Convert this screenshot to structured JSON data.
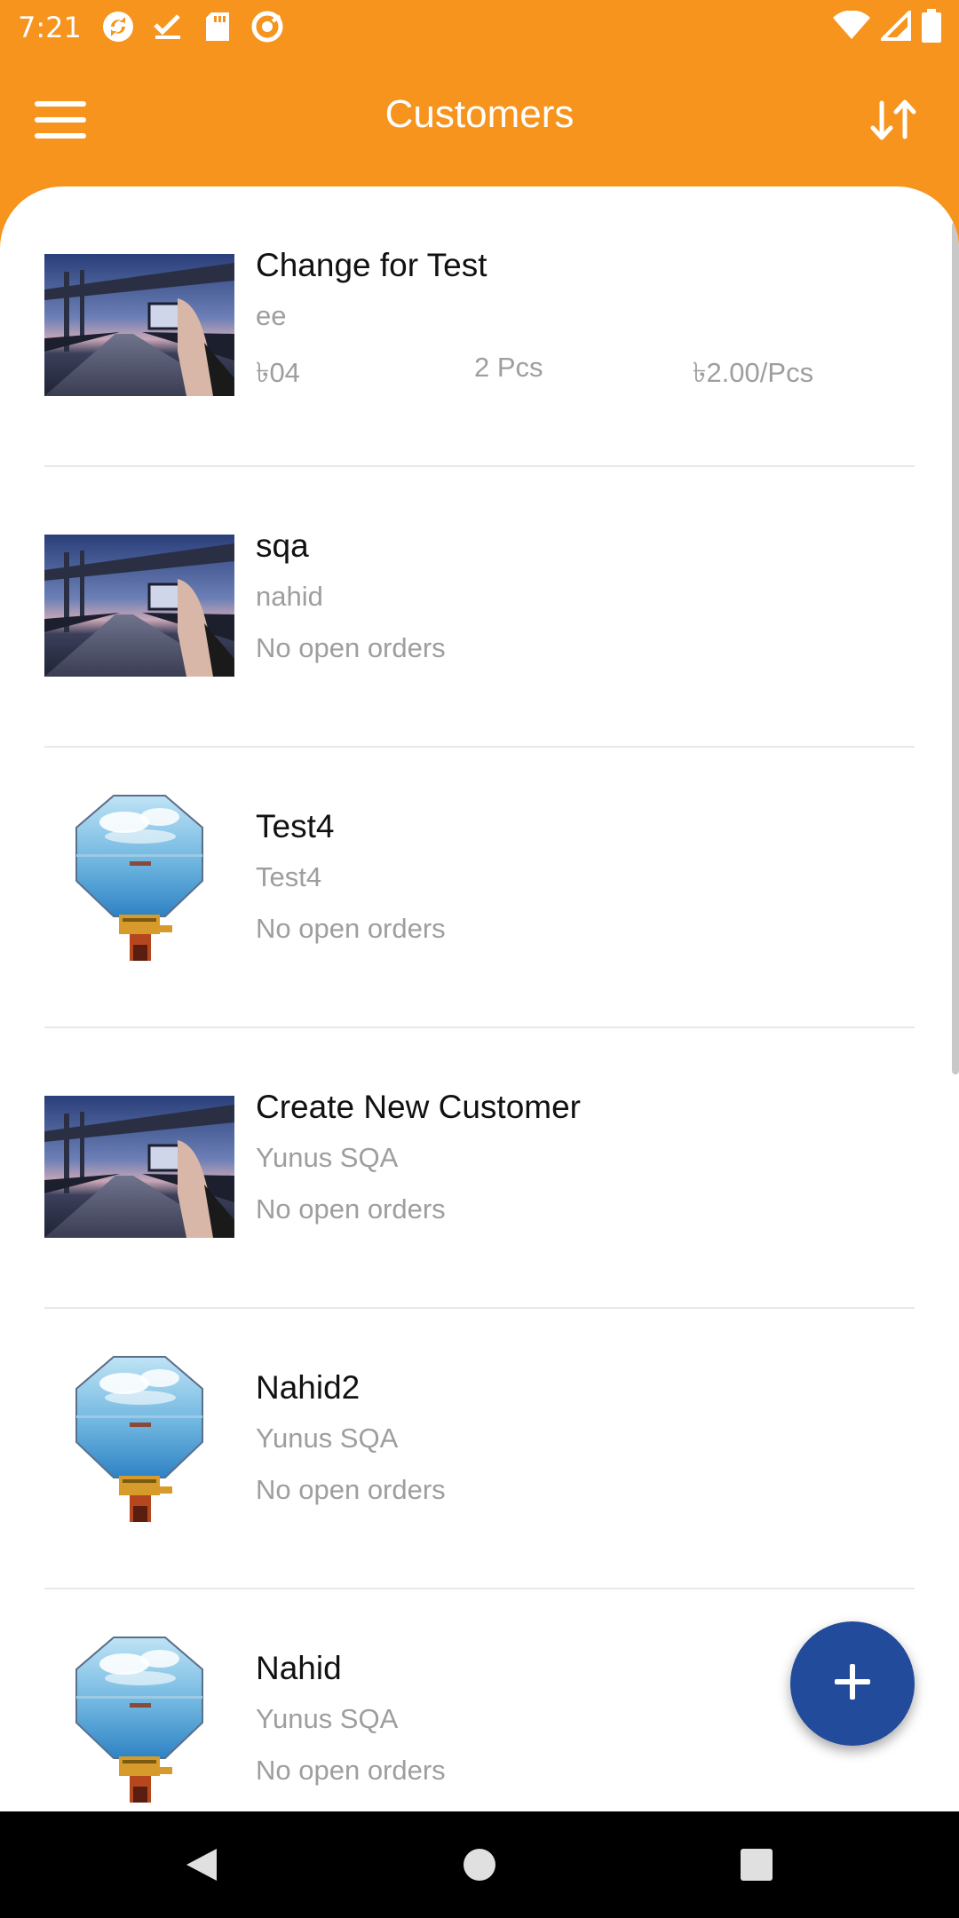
{
  "status_bar": {
    "time": "7:21",
    "icons": [
      "sync-icon",
      "checkmark-icon",
      "sd-card-icon",
      "at-sign-icon"
    ],
    "right_icons": [
      "wifi-icon",
      "cellular-signal-icon",
      "battery-icon"
    ]
  },
  "app_bar": {
    "title": "Customers",
    "menu_icon": "hamburger-menu-icon",
    "sort_icon": "sort-arrows-icon"
  },
  "customers": [
    {
      "name": "Change for Test",
      "subtitle": "ee",
      "amount": "৳04",
      "qty": "2 Pcs",
      "price": "৳2.00/Pcs",
      "image": "bridge-photo"
    },
    {
      "name": "sqa",
      "subtitle": "nahid",
      "orders": "No open orders",
      "image": "bridge-photo"
    },
    {
      "name": "Test4",
      "subtitle": "Test4",
      "orders": "No open orders",
      "image": "display-module-photo"
    },
    {
      "name": "Create New Customer",
      "subtitle": "Yunus SQA",
      "orders": "No open orders",
      "image": "bridge-photo"
    },
    {
      "name": "Nahid2",
      "subtitle": "Yunus SQA",
      "orders": "No open orders",
      "image": "display-module-photo"
    },
    {
      "name": "Nahid",
      "subtitle": "Yunus SQA",
      "orders": "No open orders",
      "image": "display-module-photo"
    }
  ],
  "fab": {
    "icon": "plus-icon"
  },
  "nav_bar": {
    "icons": [
      "back-icon",
      "home-icon",
      "recents-icon"
    ]
  },
  "colors": {
    "accent": "#f6941e",
    "fab": "#234b9c",
    "secondary_text": "#9e9e9e"
  }
}
